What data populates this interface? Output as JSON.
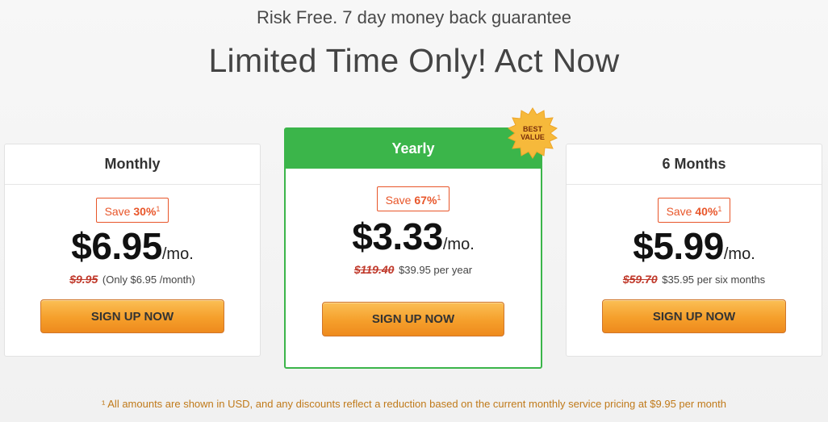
{
  "header": {
    "guarantee": "Risk Free. 7 day money back guarantee",
    "headline": "Limited Time Only! Act Now"
  },
  "plans": [
    {
      "name": "Monthly",
      "save_prefix": "Save",
      "save_pct": "30%",
      "save_mark": "1",
      "price": "$6.95",
      "unit": "/mo.",
      "old_price": "$9.95",
      "note": "(Only $6.95 /month)",
      "cta": "SIGN UP NOW"
    },
    {
      "name": "Yearly",
      "save_prefix": "Save",
      "save_pct": "67%",
      "save_mark": "1",
      "price": "$3.33",
      "unit": "/mo.",
      "old_price": "$119.40",
      "note": "$39.95 per year",
      "cta": "SIGN UP NOW",
      "badge_line1": "BEST",
      "badge_line2": "VALUE"
    },
    {
      "name": "6 Months",
      "save_prefix": "Save",
      "save_pct": "40%",
      "save_mark": "1",
      "price": "$5.99",
      "unit": "/mo.",
      "old_price": "$59.70",
      "note": "$35.95 per six months",
      "cta": "SIGN UP NOW"
    }
  ],
  "footnote": "¹ All amounts are shown in USD, and any discounts reflect a reduction based on the current monthly service pricing at $9.95 per month",
  "colors": {
    "accent_green": "#3bb54a",
    "save_orange": "#e8562a",
    "strike_red": "#c0392b",
    "button_orange": "#f59f2b",
    "badge_gold": "#f6b93b",
    "footnote_gold": "#c07a1a"
  }
}
